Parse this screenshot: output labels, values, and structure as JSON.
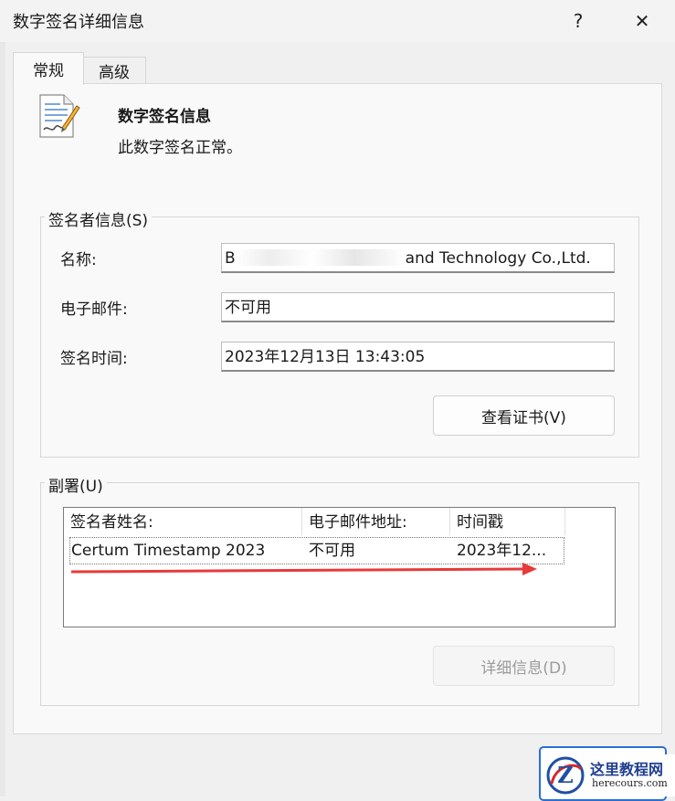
{
  "window": {
    "title": "数字签名详细信息",
    "help_label": "?",
    "close_label": "✕"
  },
  "tabs": [
    {
      "label": "常规"
    },
    {
      "label": "高级"
    }
  ],
  "header": {
    "heading": "数字签名信息",
    "status": "此数字签名正常。"
  },
  "signer": {
    "legend": "签名者信息(S)",
    "name_label": "名称:",
    "name_value_prefix": "B",
    "name_value_suffix": "and Technology Co.,Ltd.",
    "email_label": "电子邮件:",
    "email_value": "不可用",
    "time_label": "签名时间:",
    "time_value": "2023年12月13日 13:43:05",
    "view_cert_button": "查看证书(V)"
  },
  "countersign": {
    "legend": "副署(U)",
    "columns": [
      "签名者姓名:",
      "电子邮件地址:",
      "时间戳"
    ],
    "rows": [
      {
        "name": "Certum Timestamp 2023",
        "email": "不可用",
        "timestamp": "2023年12..."
      }
    ],
    "details_button": "详细信息(D)"
  },
  "watermark": {
    "text": "这里教程网",
    "url": "herecours.com"
  },
  "colors": {
    "arrow": "#e83a3a",
    "disabled_text": "#9b9b9b"
  }
}
